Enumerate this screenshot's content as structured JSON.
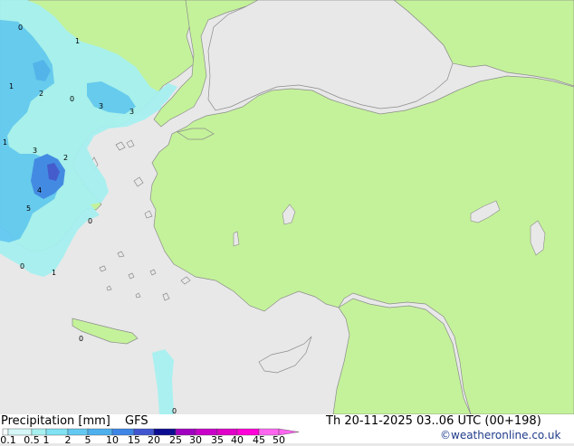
{
  "map": {
    "colors": {
      "sea": "#e8e8e8",
      "land": "#c4f29a",
      "precip_light": "#a6f0f0",
      "precip_mid": "#63c9f2",
      "precip_heavy": "#3d86e6",
      "precip_peak": "#3f55d0",
      "border": "#8c8c8c"
    },
    "contour_labels": [
      {
        "text": "0"
      },
      {
        "text": "1"
      },
      {
        "text": "1"
      },
      {
        "text": "2"
      },
      {
        "text": "0"
      },
      {
        "text": "3"
      },
      {
        "text": "3"
      },
      {
        "text": "1"
      },
      {
        "text": "3"
      },
      {
        "text": "2"
      },
      {
        "text": "4"
      },
      {
        "text": "5"
      },
      {
        "text": "0"
      },
      {
        "text": "0"
      },
      {
        "text": "1"
      },
      {
        "text": "0"
      },
      {
        "text": "0"
      }
    ]
  },
  "footer": {
    "title": "Precipitation [mm]",
    "model": "GFS",
    "datetime": "Th 20-11-2025 03..06 UTC (00+198)",
    "credit": "©weatheronline.co.uk",
    "legend": {
      "ticks": [
        "0.1",
        "0.5",
        "1",
        "2",
        "5",
        "10",
        "15",
        "20",
        "25",
        "30",
        "35",
        "40",
        "45",
        "50"
      ],
      "colors": [
        "#f5fdfd",
        "#d6f7f7",
        "#a6f0f0",
        "#80e2f2",
        "#63c9f2",
        "#4eb1ee",
        "#3d86e6",
        "#3f55d0",
        "#0c0c90",
        "#a000c0",
        "#c800c8",
        "#e000c8",
        "#ff00d8",
        "#ff66f0"
      ]
    }
  }
}
